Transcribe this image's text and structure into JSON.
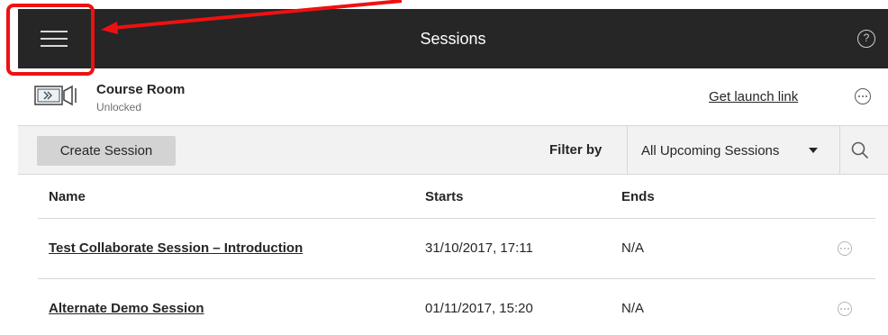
{
  "header": {
    "title": "Sessions",
    "help_symbol": "?"
  },
  "course_room": {
    "name": "Course Room",
    "status": "Unlocked",
    "launch_link": "Get launch link"
  },
  "toolbar": {
    "create_label": "Create Session",
    "filter_label": "Filter by",
    "filter_value": "All Upcoming Sessions"
  },
  "table": {
    "columns": {
      "name": "Name",
      "starts": "Starts",
      "ends": "Ends"
    },
    "rows": [
      {
        "name": "Test Collaborate Session – Introduction",
        "starts": "31/10/2017, 17:11",
        "ends": "N/A"
      },
      {
        "name": "Alternate Demo Session",
        "starts": "01/11/2017, 15:20",
        "ends": "N/A"
      }
    ]
  },
  "colors": {
    "header_bg": "#262626",
    "toolbar_bg": "#f2f2f2",
    "annotation": "#ee1111"
  },
  "icons": {
    "menu": "hamburger-menu-icon",
    "help": "help-circle-icon",
    "room": "video-room-icon",
    "more": "more-options-icon",
    "dropdown": "caret-down-icon",
    "search": "search-icon"
  }
}
